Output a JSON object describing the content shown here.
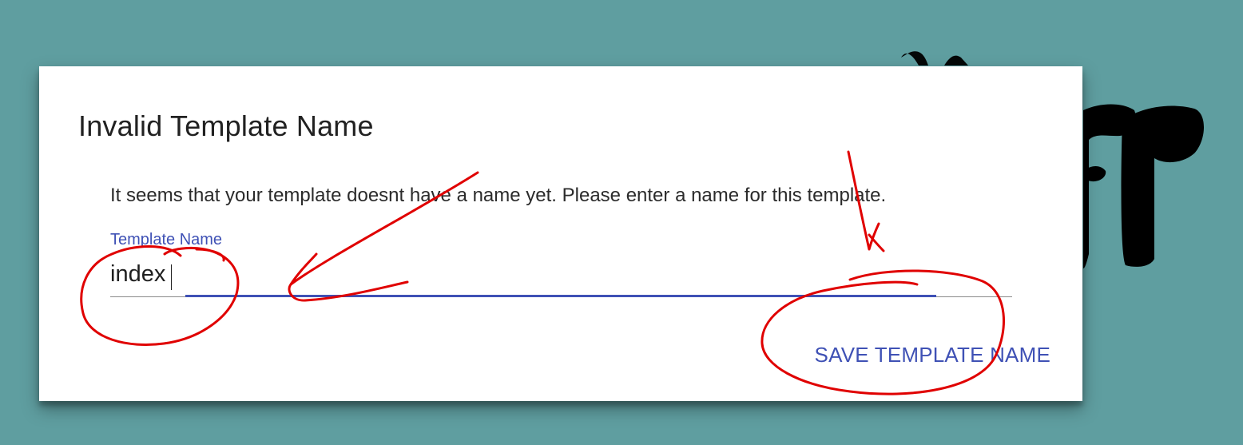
{
  "dialog": {
    "title": "Invalid Template Name",
    "message": "It seems that your template doesnt have a name yet. Please enter a name for this template.",
    "field": {
      "label": "Template Name",
      "value": "index"
    },
    "action_label": "SAVE TEMPLATE NAME"
  },
  "colors": {
    "background": "#5f9ea0",
    "accent": "#3f51b5",
    "annotation": "#e00000"
  },
  "icons": {
    "annotation_marks": "red-ink-annotations"
  }
}
